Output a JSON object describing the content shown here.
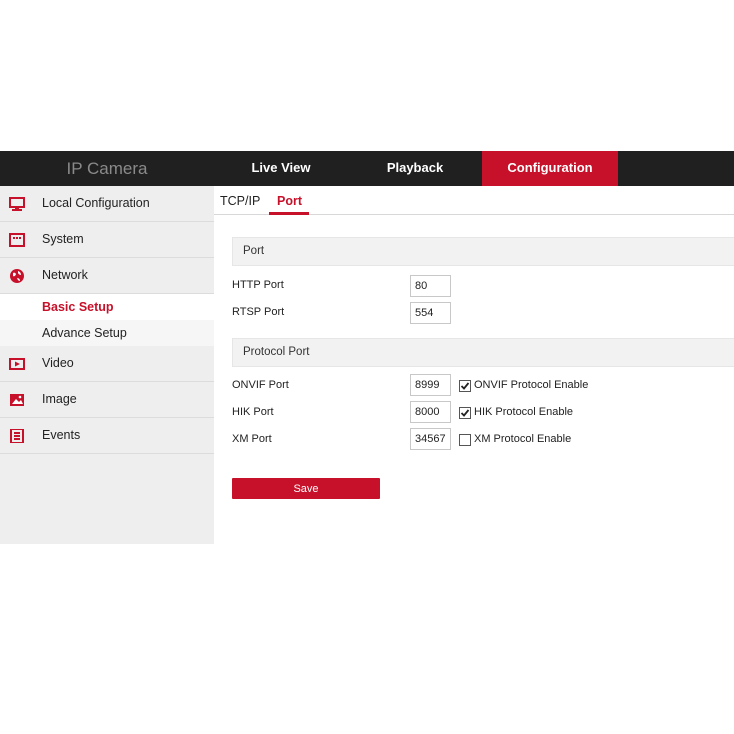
{
  "header": {
    "brand": "IP Camera",
    "nav": [
      {
        "label": "Live View"
      },
      {
        "label": "Playback"
      },
      {
        "label": "Configuration",
        "active": true
      }
    ]
  },
  "sidebar": {
    "items": [
      {
        "label": "Local Configuration",
        "icon": "monitor-icon"
      },
      {
        "label": "System",
        "icon": "system-icon"
      },
      {
        "label": "Network",
        "icon": "globe-icon"
      },
      {
        "label": "Video",
        "icon": "video-icon"
      },
      {
        "label": "Image",
        "icon": "image-icon"
      },
      {
        "label": "Events",
        "icon": "events-icon"
      }
    ],
    "network_sub": [
      {
        "label": "Basic Setup",
        "active": true
      },
      {
        "label": "Advance Setup"
      }
    ]
  },
  "main": {
    "tabs": [
      {
        "label": "TCP/IP"
      },
      {
        "label": "Port",
        "active": true
      }
    ],
    "port_section": {
      "title": "Port",
      "rows": [
        {
          "label": "HTTP Port",
          "value": "80"
        },
        {
          "label": "RTSP Port",
          "value": "554"
        }
      ]
    },
    "protocol_section": {
      "title": "Protocol Port",
      "rows": [
        {
          "label": "ONVIF Port",
          "value": "8999",
          "checkbox_label": "ONVIF Protocol Enable",
          "checked": true
        },
        {
          "label": "HIK Port",
          "value": "8000",
          "checkbox_label": "HIK Protocol Enable",
          "checked": true
        },
        {
          "label": "XM Port",
          "value": "34567",
          "checkbox_label": "XM Protocol Enable",
          "checked": false
        }
      ]
    },
    "save_label": "Save"
  },
  "colors": {
    "accent": "#c7112a",
    "topbar": "#202020",
    "sidebar_bg": "#eeeeee"
  }
}
